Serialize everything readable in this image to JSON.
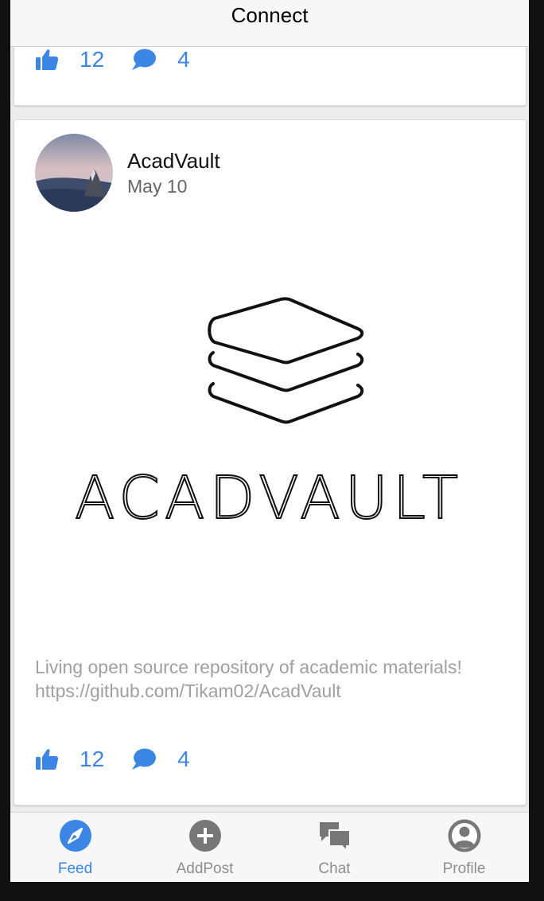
{
  "header": {
    "title": "Connect"
  },
  "posts": [
    {
      "likes": "12",
      "comments": "4"
    },
    {
      "author": "AcadVault",
      "date": "May 10",
      "image_wordmark": "ACADVAULT",
      "text": "Living open source repository of academic materials! https://github.com/Tikam02/AcadVault",
      "likes": "12",
      "comments": "4"
    }
  ],
  "tabs": [
    {
      "label": "Feed",
      "icon": "compass-icon",
      "active": true
    },
    {
      "label": "AddPost",
      "icon": "plus-circle-icon",
      "active": false
    },
    {
      "label": "Chat",
      "icon": "chat-bubbles-icon",
      "active": false
    },
    {
      "label": "Profile",
      "icon": "person-circle-icon",
      "active": false
    }
  ],
  "colors": {
    "accent": "#3b86e5",
    "inactive": "#8e8e8e",
    "background": "#ececec"
  }
}
